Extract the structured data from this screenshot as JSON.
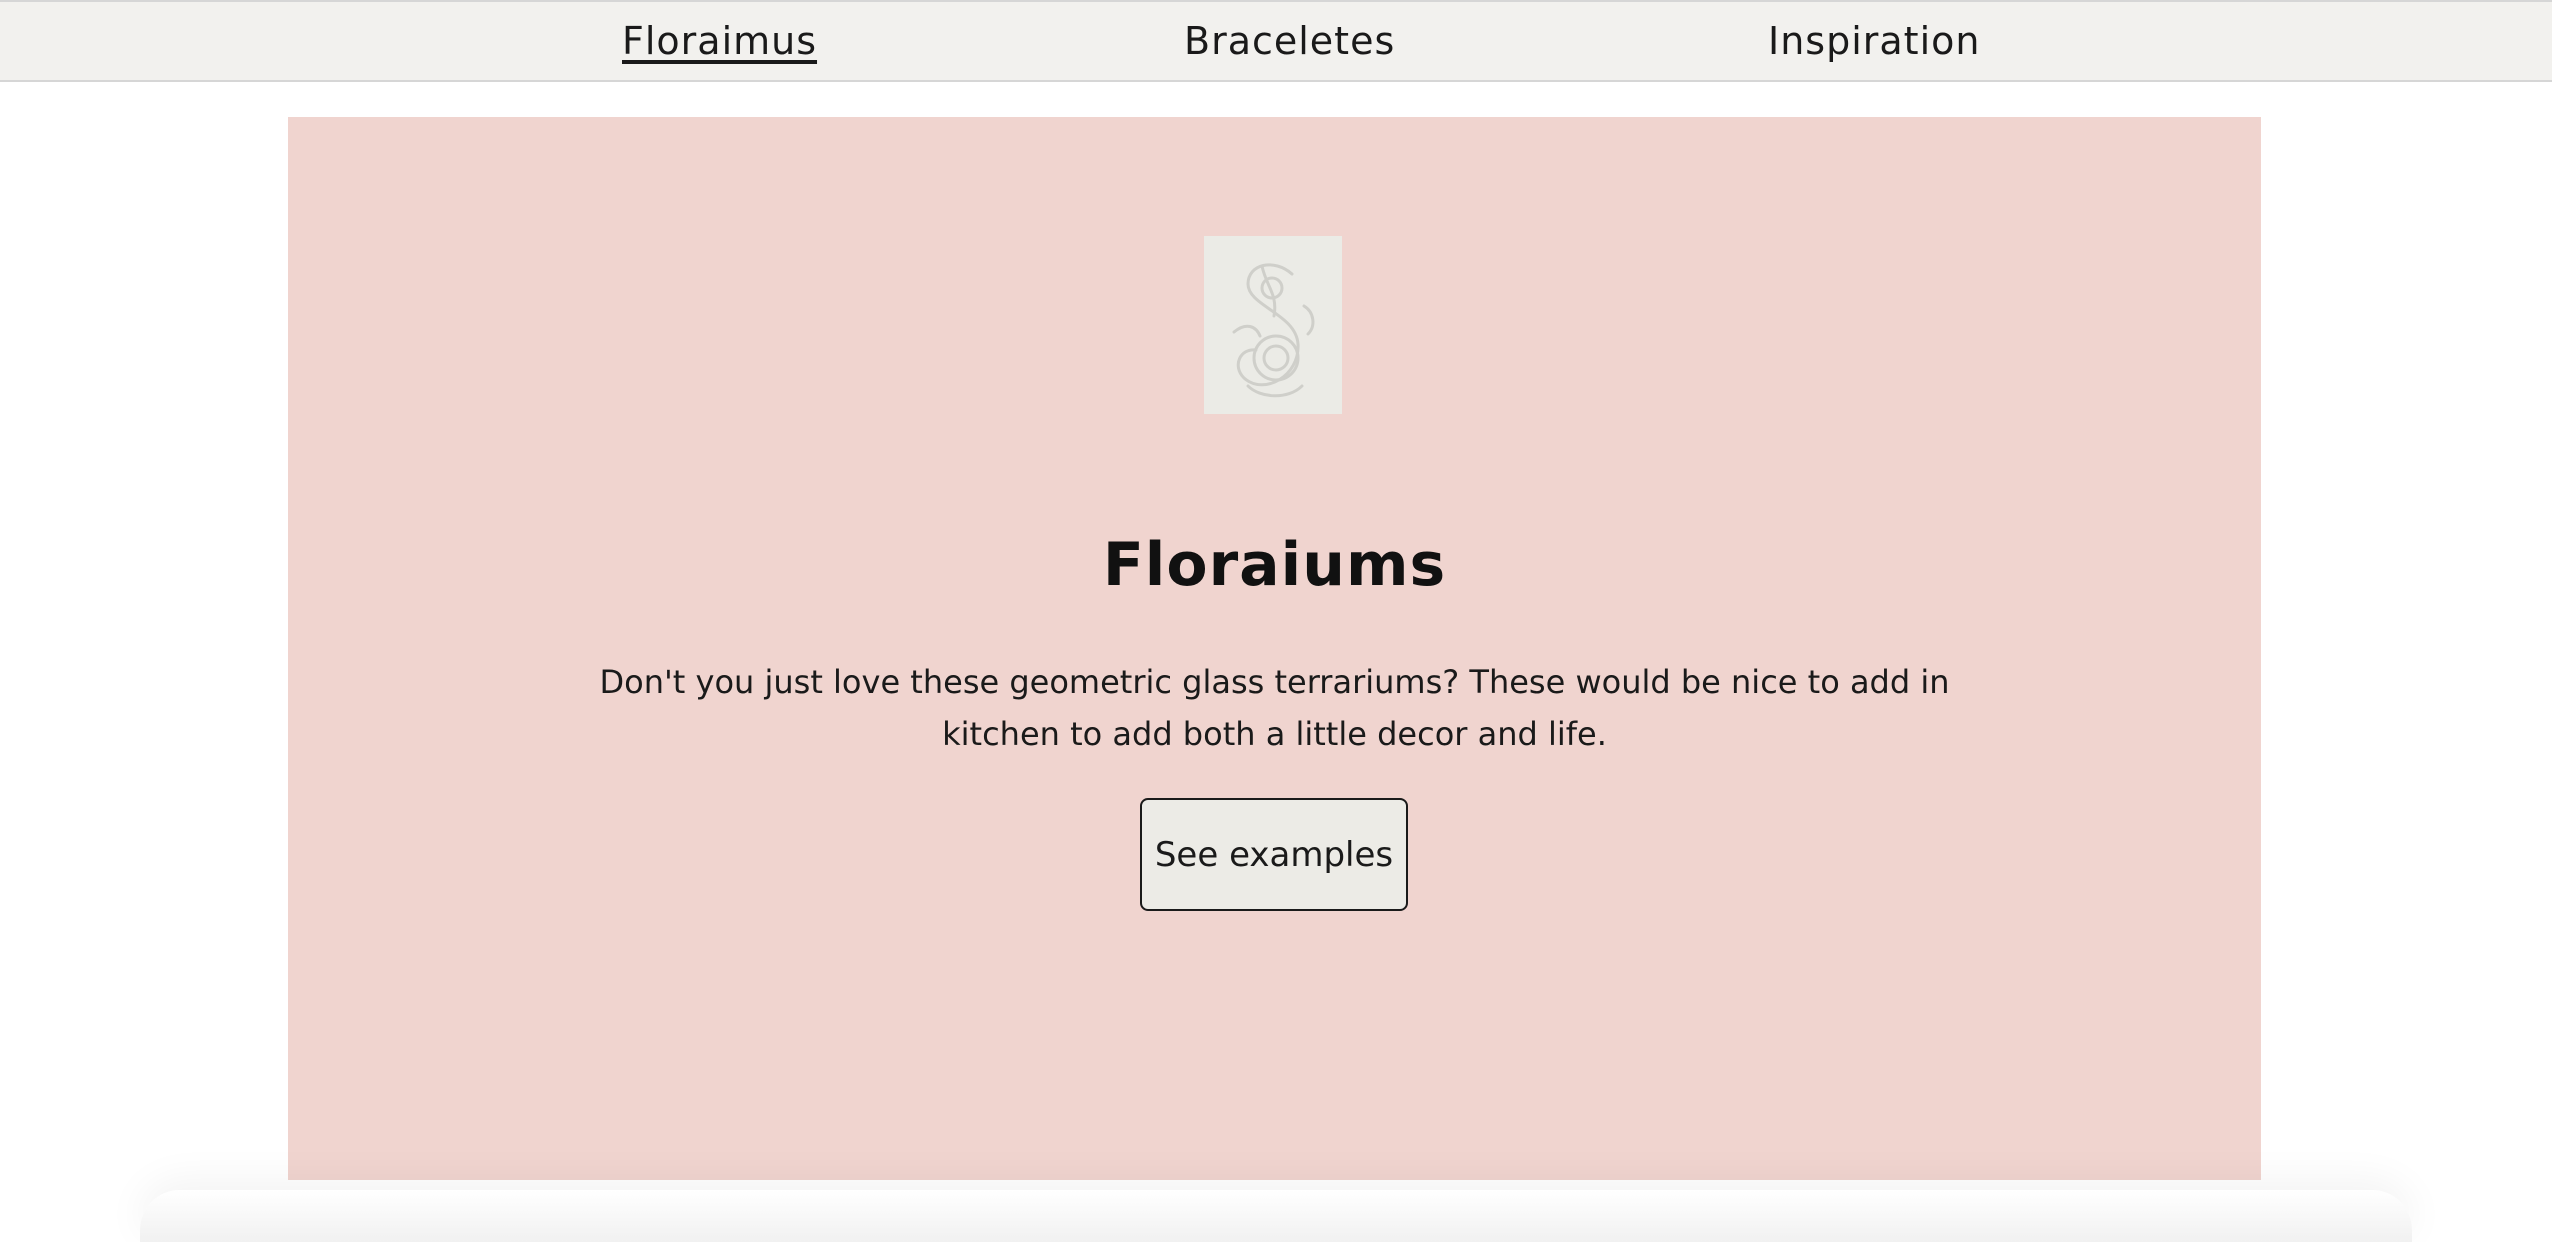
{
  "nav": {
    "items": [
      {
        "label": "Floraimus",
        "active": true
      },
      {
        "label": "Braceletes",
        "active": false
      },
      {
        "label": "Inspiration",
        "active": false
      }
    ]
  },
  "hero": {
    "logo_icon": "ornamental-s-monogram-icon",
    "title": "Floraiums",
    "description": "Don't you just love these geometric glass terrariums? These would be nice to add in kitchen to add both a little decor and life.",
    "button_label": "See examples"
  },
  "colors": {
    "nav_background": "#f2f1ee",
    "hero_background": "#f0d4cf",
    "button_background": "#ecebe6",
    "logo_background": "#ebebe6",
    "text": "#1a1a1a"
  }
}
